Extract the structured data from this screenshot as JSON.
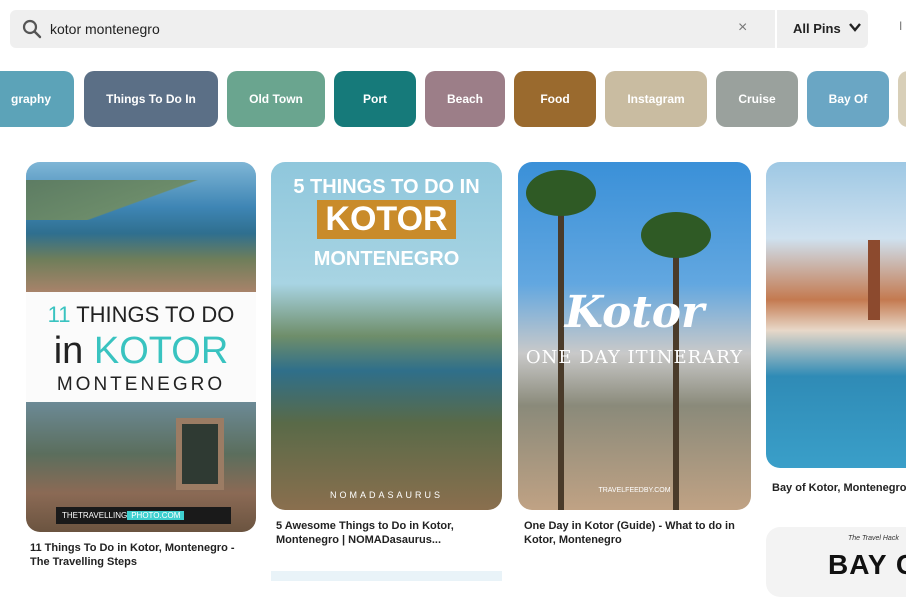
{
  "search": {
    "query": "kotor montenegro",
    "clear_icon": "×",
    "filter_label": "All Pins",
    "edge_label": "I"
  },
  "chips": [
    {
      "label": "graphy",
      "color": "#5ca3b8"
    },
    {
      "label": "Things To Do In",
      "color": "#5b6f86"
    },
    {
      "label": "Old Town",
      "color": "#6aa58f"
    },
    {
      "label": "Port",
      "color": "#167a7a"
    },
    {
      "label": "Beach",
      "color": "#9c7e88"
    },
    {
      "label": "Food",
      "color": "#9a6a2e"
    },
    {
      "label": "Instagram",
      "color": "#c9bca1"
    },
    {
      "label": "Cruise",
      "color": "#9aa19d"
    },
    {
      "label": "Bay Of",
      "color": "#6aa6c4"
    },
    {
      "label": "",
      "color": "#d8cfb8"
    }
  ],
  "pins": [
    {
      "overlay": {
        "line1_num": "11",
        "line1_rest": " THINGS TO DO",
        "line2_a": "in ",
        "line2_b": "KOTOR",
        "line3": "MONTENEGRO",
        "brand_a": "THETRAVELLING",
        "brand_b": "PHOTO.COM"
      },
      "caption": "11 Things To Do in Kotor, Montenegro - The Travelling Steps"
    },
    {
      "overlay": {
        "line1": "5 THINGS TO DO IN",
        "line2": "KOTOR",
        "line3": "MONTENEGRO",
        "watermark": "NOMADASAURUS"
      },
      "caption": "5 Awesome Things to Do in Kotor, Montenegro | NOMADasaurus..."
    },
    {
      "overlay": {
        "title": "Kotor",
        "subtitle": "ONE DAY ITINERARY",
        "watermark": "TRAVELFEEDBY.COM"
      },
      "caption": "One Day in Kotor (Guide) - What to do in Kotor, Montenegro"
    },
    {
      "caption": "Bay of Kotor, Montenegro"
    },
    {
      "overlay": {
        "small": "The Travel Hack",
        "big": "BAY C"
      }
    }
  ]
}
